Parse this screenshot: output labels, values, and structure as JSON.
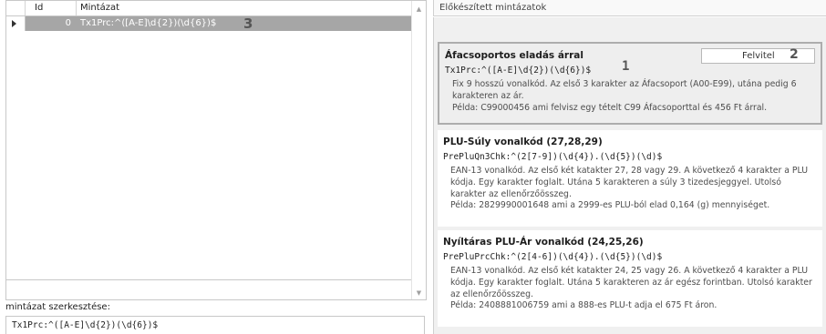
{
  "grid": {
    "columns": {
      "id": "Id",
      "pattern": "Mintázat"
    },
    "rows": [
      {
        "id": "0",
        "pattern": "Tx1Prc:^([A-E]\\d{2})(\\d{6})$",
        "marker": "3"
      }
    ]
  },
  "editor": {
    "label": "mintázat szerkesztése:",
    "value": "Tx1Prc:^([A-E]\\d{2})(\\d{6})$"
  },
  "templates_panel": {
    "title": "Előkészített mintázatok",
    "add_button": {
      "label": "Felvitel",
      "marker": "2"
    },
    "items": [
      {
        "title": "Áfacsoportos eladás árral",
        "regex": "Tx1Prc:^([A-E]\\d{2})(\\d{6})$",
        "marker": "1",
        "desc": "Fix 9 hosszú vonalkód. Az első 3 karakter az Áfacsoport (A00-E99), utána pedig 6 karakteren az ár.",
        "example": "Példa: C99000456 ami felvisz egy tételt C99 Áfacsoporttal és 456 Ft árral."
      },
      {
        "title": "PLU-Súly vonalkód (27,28,29)",
        "regex": "PrePluQn3Chk:^(2[7-9])(\\d{4}).(\\d{5})(\\d)$",
        "desc": "EAN-13 vonalkód. Az első két katakter 27, 28 vagy 29. A következő 4 karakter a PLU kódja. Egy karakter foglalt. Utána 5 karakteren a súly 3 tizedesjeggyel. Utolsó karakter az ellenőrzőösszeg.",
        "example": "Példa: 2829990001648 ami a 2999-es PLU-ból elad 0,164 (g) mennyiséget."
      },
      {
        "title": "Nyíltáras PLU-Ár vonalkód (24,25,26)",
        "regex": "PrePluPrcChk:^(2[4-6])(\\d{4}).(\\d{5})(\\d)$",
        "desc": "EAN-13 vonalkód. Az első két katakter 24, 25 vagy 26. A következő 4 karakter a PLU kódja. Egy karakter foglalt. Utána 5 karakteren az ár egész forintban. Utolsó karakter az ellenőrzőösszeg.",
        "example": "Példa: 2408881006759 ami a 888-es PLU-t adja el 675 Ft áron."
      }
    ]
  },
  "icons": {
    "row_pointer": "triangle-right-icon",
    "scroll_up": "scroll-up-arrow-icon",
    "scroll_down": "scroll-down-arrow-icon"
  }
}
